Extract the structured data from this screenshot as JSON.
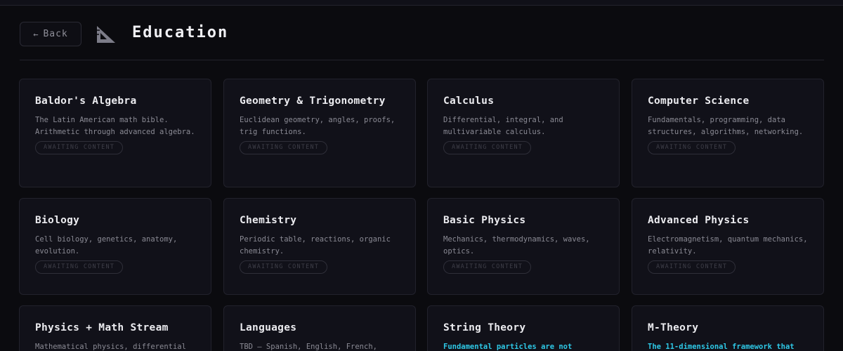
{
  "header": {
    "back_arrow": "←",
    "back_label": "Back",
    "title": "Education"
  },
  "badge_text": "AWAITING CONTENT",
  "colors": {
    "accent": "#2ec8e6",
    "background": "#0b0b0f",
    "card": "#111119"
  },
  "cards": [
    {
      "title": "Baldor's Algebra",
      "desc": "The Latin American math bible. Arithmetic through advanced algebra."
    },
    {
      "title": "Geometry & Trigonometry",
      "desc": "Euclidean geometry, angles, proofs, trig functions."
    },
    {
      "title": "Calculus",
      "desc": "Differential, integral, and multivariable calculus."
    },
    {
      "title": "Computer Science",
      "desc": "Fundamentals, programming, data structures, algorithms, networking."
    },
    {
      "title": "Biology",
      "desc": "Cell biology, genetics, anatomy, evolution."
    },
    {
      "title": "Chemistry",
      "desc": "Periodic table, reactions, organic chemistry."
    },
    {
      "title": "Basic Physics",
      "desc": "Mechanics, thermodynamics, waves, optics."
    },
    {
      "title": "Advanced Physics",
      "desc": "Electromagnetism, quantum mechanics, relativity."
    },
    {
      "title": "Physics + Math Stream",
      "desc": "Mathematical physics, differential"
    },
    {
      "title": "Languages",
      "desc": "TBD — Spanish, English, French,"
    },
    {
      "title": "String Theory",
      "desc": "Fundamental particles are not"
    },
    {
      "title": "M-Theory",
      "desc": "The 11-dimensional framework that"
    }
  ]
}
